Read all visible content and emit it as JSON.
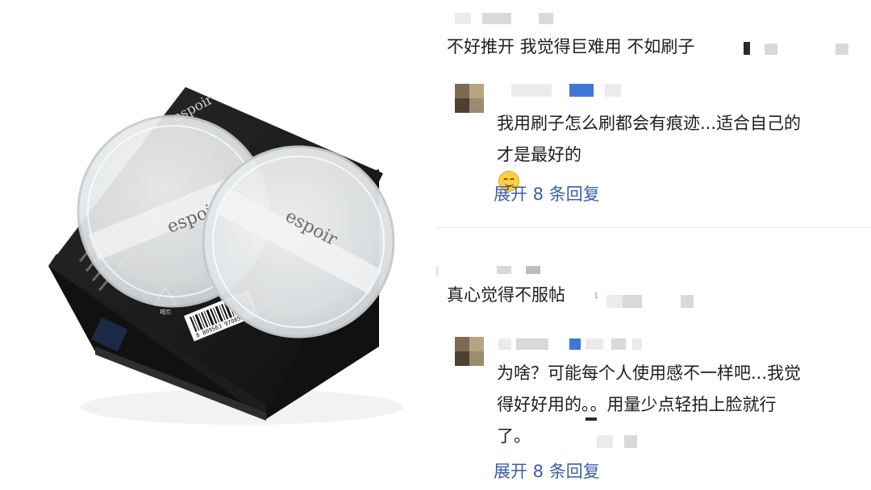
{
  "product": {
    "brand_box": "espoir",
    "brand_puff_left": "espoir",
    "brand_puff_right": "espoir",
    "barcode_number": "8 809563 970858",
    "recycle_label": "페트"
  },
  "comments": [
    {
      "text": "不好推开  我觉得巨难用  不如刷子",
      "reply": {
        "lines": [
          "我用刷子怎么刷都会有痕迹...适合自己的",
          "才是最好的"
        ],
        "emoji": "smiling-face-icon",
        "expand_label": "展开 8 条回复"
      }
    },
    {
      "text": "真心觉得不服帖",
      "reply": {
        "lines": [
          "为啥？可能每个人使用感不一样吧...我觉",
          "得好好用的。。用量少点轻拍上脸就行",
          "了。"
        ],
        "expand_label": "展开 8 条回复"
      }
    }
  ],
  "colors": {
    "link": "#3a5fa8",
    "text": "#1e1e1e",
    "box": "#1a1a1a",
    "puff": "#e6e8ea"
  }
}
